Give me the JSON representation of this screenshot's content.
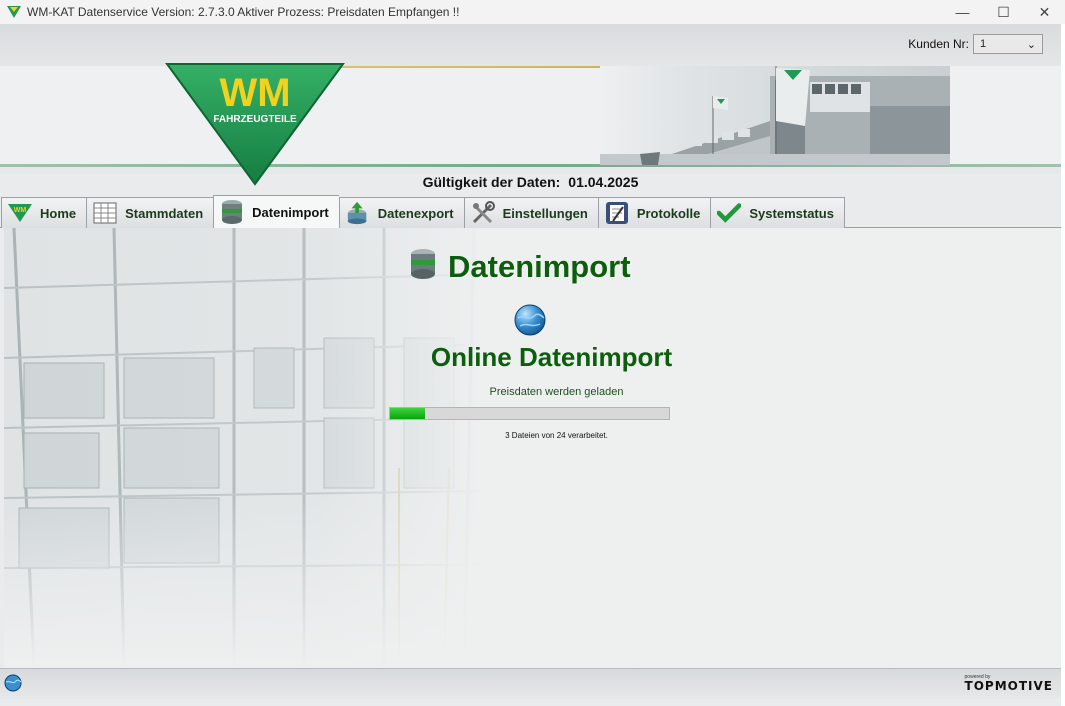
{
  "window": {
    "title": "WM-KAT Datenservice  Version: 2.7.3.0 Aktiver Prozess: Preisdaten Empfangen !!",
    "minimize": "—",
    "maximize": "☐",
    "close": "✕"
  },
  "header": {
    "kunden_label": "Kunden Nr:",
    "kunden_value": "1",
    "logo_text": "WM",
    "logo_subtext": "FAHRZEUGTEILE"
  },
  "validity": {
    "label": "Gültigkeit der Daten:",
    "date": "01.04.2025"
  },
  "tabs": [
    {
      "label": "Home",
      "icon": "wm-triangle-icon"
    },
    {
      "label": "Stammdaten",
      "icon": "table-icon"
    },
    {
      "label": "Datenimport",
      "icon": "database-icon",
      "active": true
    },
    {
      "label": "Datenexport",
      "icon": "database-export-icon"
    },
    {
      "label": "Einstellungen",
      "icon": "tools-icon"
    },
    {
      "label": "Protokolle",
      "icon": "log-icon"
    },
    {
      "label": "Systemstatus",
      "icon": "checkmark-icon"
    }
  ],
  "content": {
    "heading": "Datenimport",
    "subheading": "Online Datenimport",
    "status": "Preisdaten werden geladen",
    "progress": 0.125,
    "count": "3 Dateien von 24 verarbeitet."
  },
  "footer": {
    "powered": "powered by",
    "brand": "TOPMOTIVE"
  },
  "colors": {
    "accent_green": "#0c5e0c",
    "progress_green": "#0aa50a",
    "logo_green": "#1f9a52",
    "logo_yellow": "#f2d21c"
  }
}
